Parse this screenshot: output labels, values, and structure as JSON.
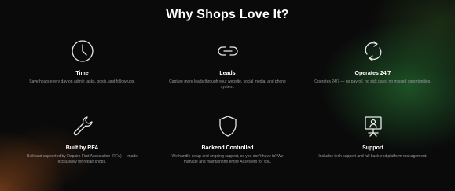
{
  "heading": "Why Shops Love It?",
  "features": [
    {
      "icon": "clock-icon",
      "title": "Time",
      "description": "Save hours every day on admin tasks, posts, and follow-ups."
    },
    {
      "icon": "link-icon",
      "title": "Leads",
      "description": "Capture more leads through your website, social media, and phone system."
    },
    {
      "icon": "refresh-icon",
      "title": "Operates 24/7",
      "description": "Operates 24/7 — no payroll, no sick days, no missed opportunities."
    },
    {
      "icon": "wrench-icon",
      "title": "Built by RFA",
      "description": "Built and supported by Repairs First Association (RFA) — made exclusively for repair shops."
    },
    {
      "icon": "shield-icon",
      "title": "Backend Controlled",
      "description": "We handle setup and ongoing support, so you don't have to! We manage and maintain the entire AI system for you."
    },
    {
      "icon": "support-icon",
      "title": "Support",
      "description": "Includes tech support and full back end platform management."
    }
  ]
}
